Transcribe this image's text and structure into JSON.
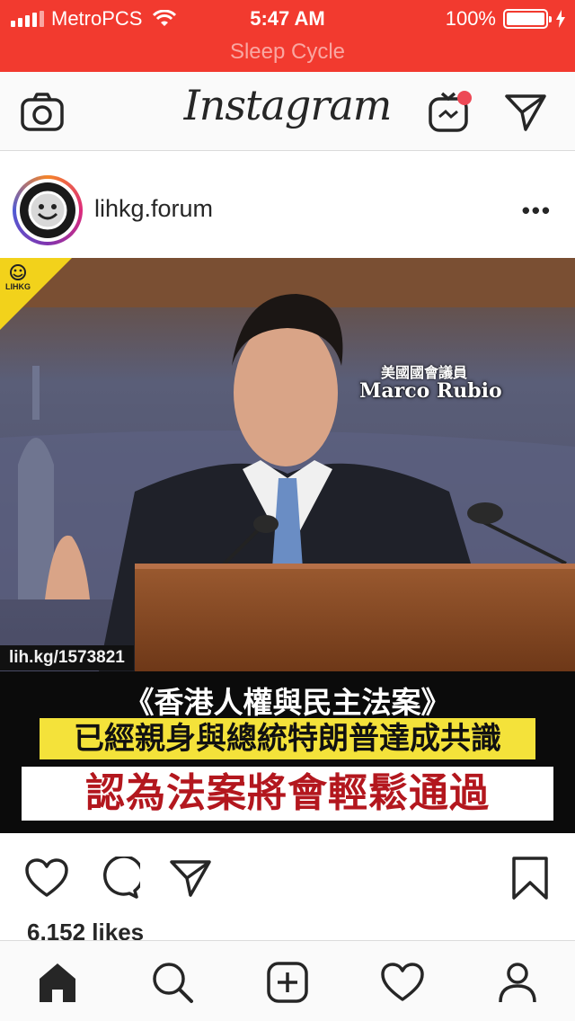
{
  "status_bar": {
    "carrier": "MetroPCS",
    "time": "5:47 AM",
    "battery": "100%",
    "app_banner": "Sleep Cycle",
    "background_color": "#f23a2f"
  },
  "header": {
    "logo": "Instagram",
    "left_icon": "camera-icon",
    "right_icons": [
      "igtv-icon",
      "direct-message-icon"
    ]
  },
  "post": {
    "username": "lihkg.forum",
    "more_icon": "more-options-icon",
    "image": {
      "corner_badge": "LIHKG",
      "name_caption_small": "美國國會議員",
      "name_caption": "Marco Rubio",
      "link": "lih.kg/1573821",
      "line1": "《香港人權與民主法案》",
      "line2": "已經親身與總統特朗普達成共識",
      "line3": "認為法案將會輕鬆通過"
    },
    "actions": [
      "like-icon",
      "comment-icon",
      "share-icon",
      "save-icon"
    ],
    "likes": "6,152 likes"
  },
  "bottom_nav": [
    "home-icon",
    "search-icon",
    "new-post-icon",
    "activity-icon",
    "profile-icon"
  ]
}
